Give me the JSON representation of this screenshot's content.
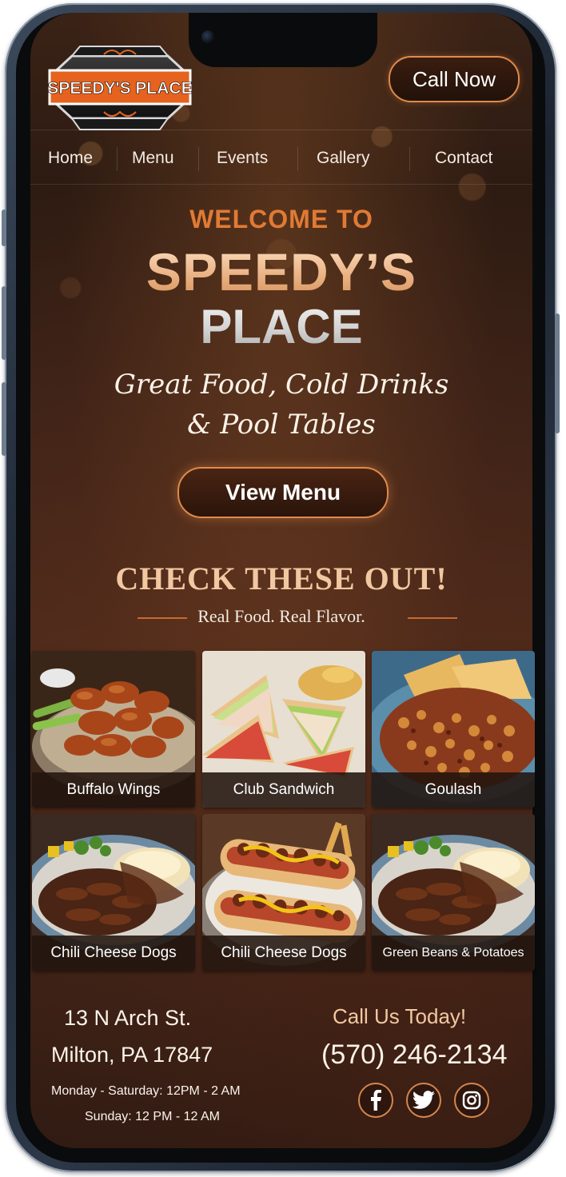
{
  "brand": {
    "logo_text": "SPEEDY'S PLACE",
    "call_now_label": "Call Now",
    "accent_color": "#e08a4a"
  },
  "nav": {
    "items": [
      {
        "label": "Home"
      },
      {
        "label": "Menu"
      },
      {
        "label": "Events"
      },
      {
        "label": "Gallery"
      },
      {
        "label": "Contact"
      }
    ]
  },
  "hero": {
    "welcome": "WELCOME TO",
    "title_line1": "SPEEDY’S",
    "title_line2": "PLACE",
    "tagline_line1": "Great Food, Cold Drinks",
    "tagline_line2": "& Pool Tables",
    "cta_label": "View Menu"
  },
  "featured": {
    "heading": "CHECK THESE OUT!",
    "subheading": "Real Food. Real Flavor.",
    "items": [
      {
        "label": "Buffalo Wings",
        "image": "buffalo-wings"
      },
      {
        "label": "Club Sandwich",
        "image": "club-sandwich"
      },
      {
        "label": "Goulash",
        "image": "goulash"
      },
      {
        "label": "Chili Cheese Dogs",
        "image": "beef-plate"
      },
      {
        "label": "Chili Cheese Dogs",
        "image": "chili-dogs"
      },
      {
        "label": "Green Beans & Potatoes",
        "image": "beef-plate"
      }
    ]
  },
  "footer": {
    "address_line1": "13 N Arch St.",
    "address_line2": "Milton, PA 17847",
    "hours_line1": "Monday - Saturday: 12PM - 2 AM",
    "hours_line2": "Sunday: 12 PM - 12 AM",
    "call_heading": "Call Us Today!",
    "phone": "(570) 246-2134",
    "social": [
      {
        "icon": "facebook-icon"
      },
      {
        "icon": "twitter-icon"
      },
      {
        "icon": "instagram-icon"
      }
    ]
  }
}
